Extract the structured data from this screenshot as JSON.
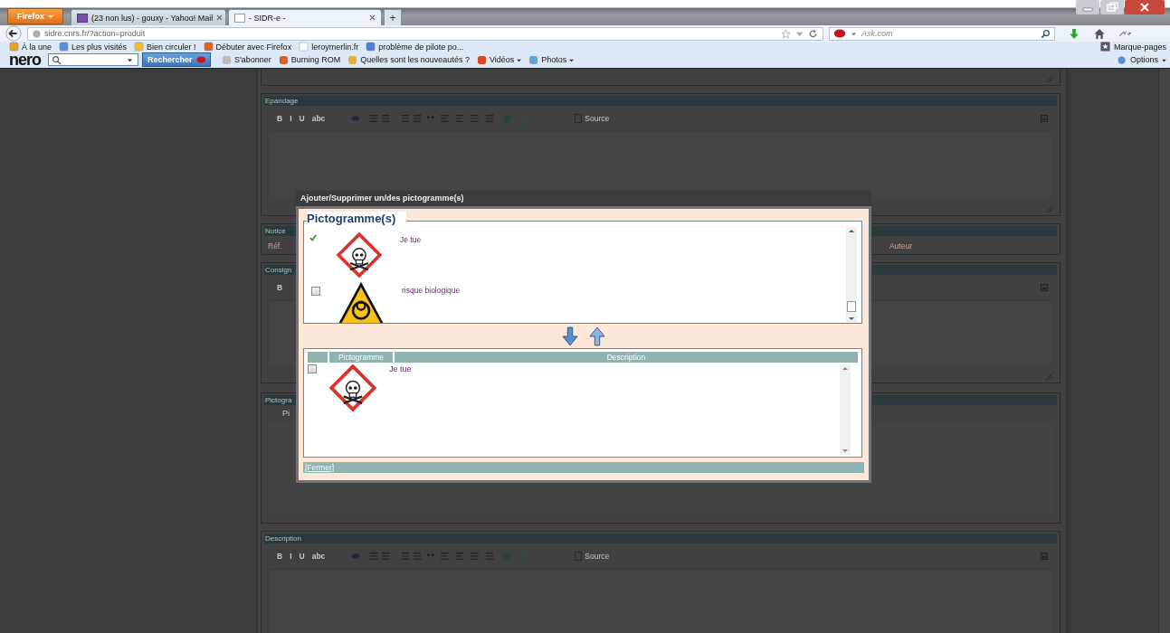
{
  "browser": {
    "menu_button": "Firefox",
    "tabs": [
      {
        "title": "(23 non lus) - gouxy - Yahoo! Mail",
        "selected": false
      },
      {
        "title": "- SIDR-e -",
        "selected": true
      }
    ],
    "new_tab": "+",
    "url": "sidre.cnrs.fr/?action=produit",
    "search_placeholder": "Ask.com",
    "bookmarks": [
      "À la une",
      "Les plus visités",
      "Bien circuler !",
      "Débuter avec Firefox",
      "leroymerlin.fr",
      "problème de pilote po..."
    ],
    "bookmarks_menu": "Marque-pages",
    "toolbar": {
      "logo": "nero",
      "search_button": "Rechercher",
      "items": [
        {
          "label": "S'abonner",
          "dropdown": false
        },
        {
          "label": "Burning ROM",
          "dropdown": false
        },
        {
          "label": "Quelles sont les nouveautés ?",
          "dropdown": false
        },
        {
          "label": "Vidéos",
          "dropdown": true
        },
        {
          "label": "Photos",
          "dropdown": true
        }
      ],
      "options": "Options"
    }
  },
  "page": {
    "sections": [
      {
        "kind": "editor",
        "title": "Epandage",
        "buttons": [
          "B",
          "I",
          "U",
          "abc"
        ],
        "source": "Source"
      },
      {
        "kind": "notice",
        "title": "Notice",
        "columns": [
          "Réf.",
          "Auteur"
        ]
      },
      {
        "kind": "covered_editor",
        "title": "Consign",
        "buttons": [
          "B"
        ]
      },
      {
        "kind": "list",
        "title": "Pictogra",
        "column": "Pi"
      },
      {
        "kind": "editor",
        "title": "Description",
        "buttons": [
          "B",
          "I",
          "U",
          "abc"
        ],
        "source": "Source"
      }
    ]
  },
  "dialog": {
    "title": "Ajouter/Supprimer un/des pictogramme(s)",
    "legend": "Pictogramme(s)",
    "available": [
      {
        "label": "Je tue",
        "checked": true,
        "kind": "skull"
      },
      {
        "label": "risque biologique",
        "checked": false,
        "kind": "biohazard"
      }
    ],
    "table": {
      "columns": [
        "Pictogramme",
        "Description"
      ],
      "rows": [
        {
          "description": "Je tue",
          "checked": false,
          "kind": "skull"
        }
      ]
    },
    "close_link": "[Fermer]"
  }
}
